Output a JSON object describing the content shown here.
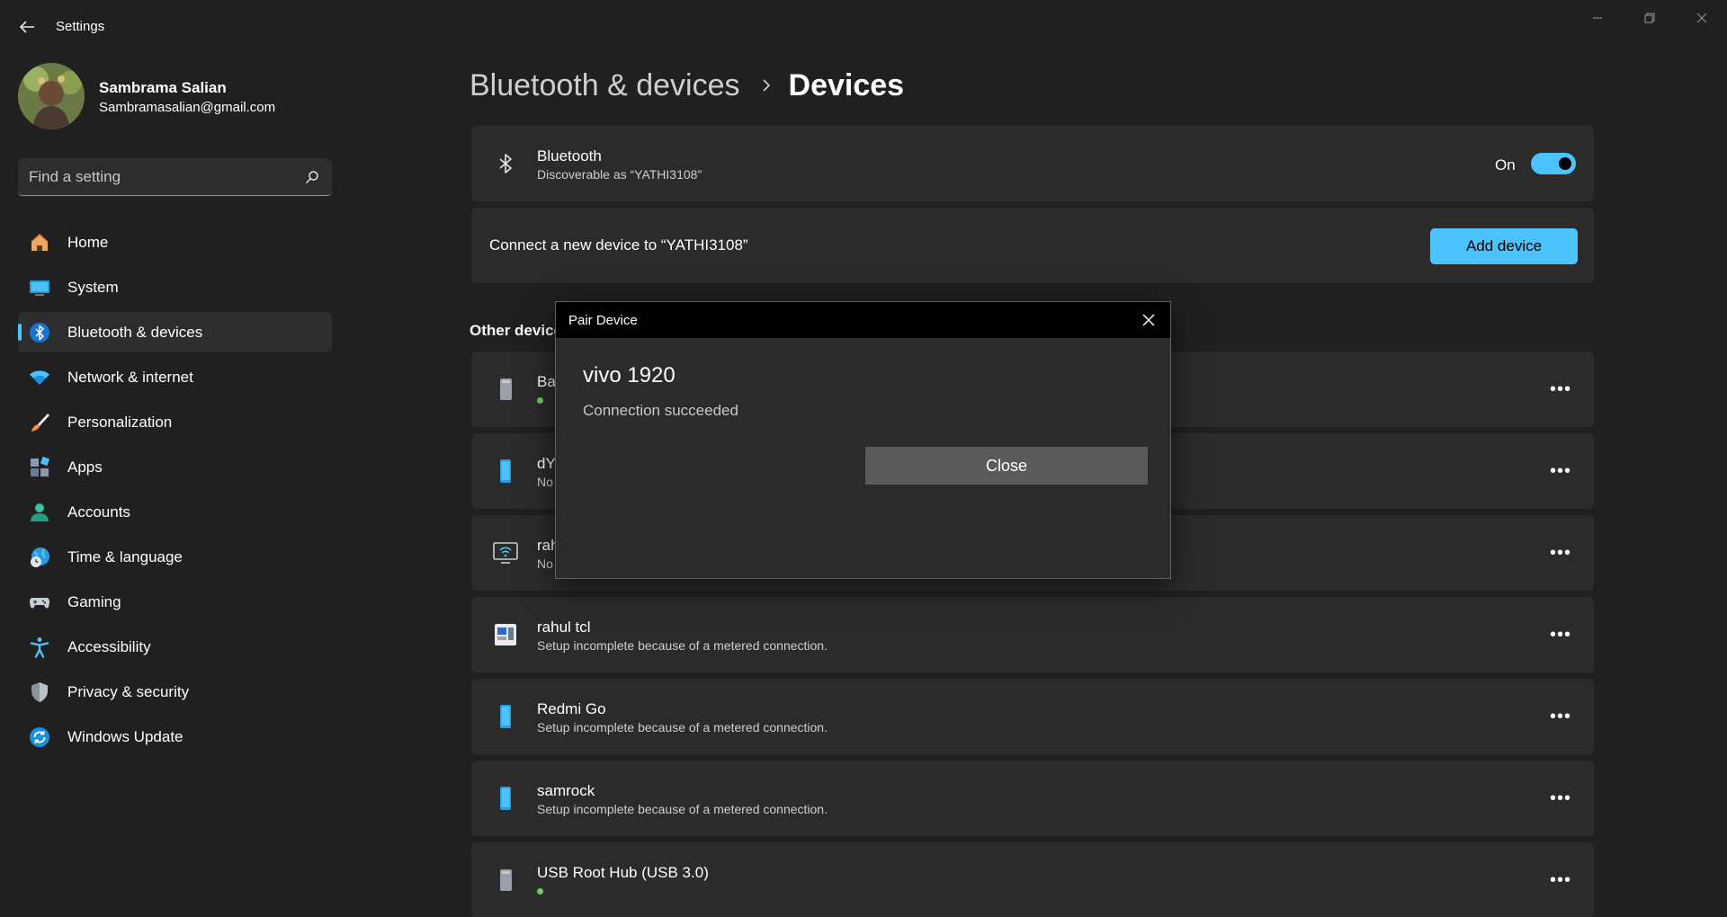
{
  "window": {
    "title": "Settings"
  },
  "profile": {
    "name": "Sambrama Salian",
    "email": "Sambramasalian@gmail.com"
  },
  "search": {
    "placeholder": "Find a setting"
  },
  "sidebar": {
    "items": [
      {
        "label": "Home",
        "icon": "home-icon"
      },
      {
        "label": "System",
        "icon": "monitor-icon"
      },
      {
        "label": "Bluetooth & devices",
        "icon": "bluetooth-icon",
        "active": true
      },
      {
        "label": "Network & internet",
        "icon": "wifi-icon"
      },
      {
        "label": "Personalization",
        "icon": "brush-icon"
      },
      {
        "label": "Apps",
        "icon": "apps-icon"
      },
      {
        "label": "Accounts",
        "icon": "person-icon"
      },
      {
        "label": "Time & language",
        "icon": "globe-clock-icon"
      },
      {
        "label": "Gaming",
        "icon": "gamepad-icon"
      },
      {
        "label": "Accessibility",
        "icon": "accessibility-icon"
      },
      {
        "label": "Privacy & security",
        "icon": "shield-icon"
      },
      {
        "label": "Windows Update",
        "icon": "update-icon"
      }
    ]
  },
  "breadcrumb": {
    "parent": "Bluetooth & devices",
    "current": "Devices"
  },
  "bluetooth": {
    "title": "Bluetooth",
    "subtitle": "Discoverable as “YATHI3108”",
    "state_label": "On",
    "enabled": true
  },
  "connect": {
    "text": "Connect a new device to “YATHI3108”",
    "button": "Add device"
  },
  "section": {
    "title": "Other devices"
  },
  "devices": [
    {
      "name": "Ba",
      "status": "",
      "connected": true,
      "icon": "generic-device-icon"
    },
    {
      "name": "dY",
      "status": "No",
      "connected": false,
      "icon": "phone-icon"
    },
    {
      "name": "rah",
      "status": "No",
      "connected": false,
      "icon": "wireless-display-icon"
    },
    {
      "name": "rahul tcl",
      "status": "Setup incomplete because of a metered connection.",
      "connected": false,
      "icon": "media-device-icon"
    },
    {
      "name": "Redmi Go",
      "status": "Setup incomplete because of a metered connection.",
      "connected": false,
      "icon": "phone-icon"
    },
    {
      "name": "samrock",
      "status": "Setup incomplete because of a metered connection.",
      "connected": false,
      "icon": "phone-icon"
    },
    {
      "name": "USB Root Hub (USB 3.0)",
      "status": "",
      "connected": true,
      "icon": "generic-device-icon"
    }
  ],
  "more_label": "•••",
  "dialog": {
    "title": "Pair Device",
    "device_name": "vivo 1920",
    "message": "Connection succeeded",
    "button": "Close"
  },
  "colors": {
    "background": "#202020",
    "card": "#2b2b2b",
    "accent": "#4cc2ff",
    "connected_dot": "#6ccb5f"
  }
}
